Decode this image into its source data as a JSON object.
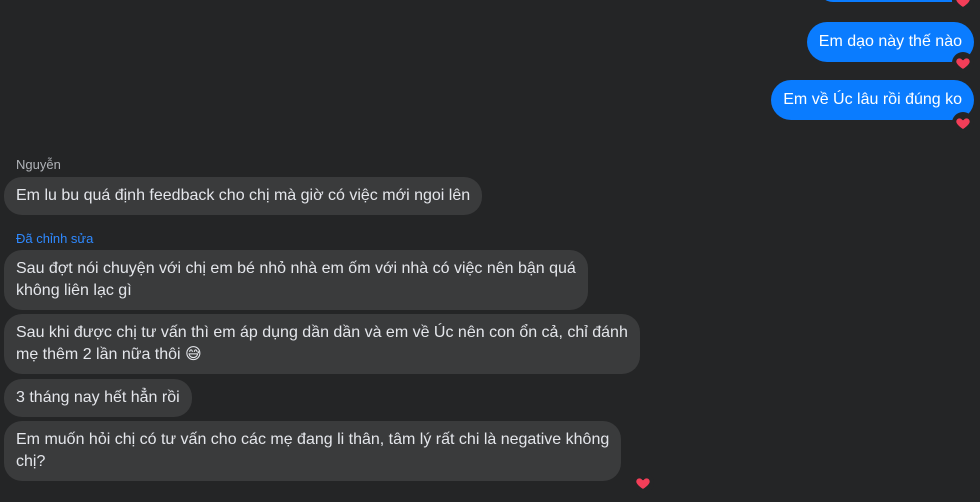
{
  "outgoing": {
    "msg1": "Em dạo này thế nào",
    "msg2": "Em về Úc lâu rồi đúng ko"
  },
  "incoming": {
    "sender_name": "Nguyễn",
    "msg1": "Em lu bu quá định feedback cho chị mà giờ có việc mới ngoi lên",
    "edited_label": "Đã chỉnh sửa",
    "msg2_line1": "Sau đợt nói chuyện với chị em bé nhỏ nhà em ốm với nhà có việc nên bận quá",
    "msg2_line2": "không liên lạc gì",
    "msg3_line1": "Sau khi được chị tư vấn thì em áp dụng dần dần và em về Úc nên con ổn cả, chỉ đánh",
    "msg3_line2": "mẹ thêm 2 lần nữa thôi 😅",
    "msg4": "3 tháng nay hết hẳn rồi",
    "msg5_line1": "Em muốn hỏi chị có tư vấn cho các mẹ đang li thân, tâm lý rất chi là negative không",
    "msg5_line2": "chị?"
  },
  "reaction_icon": "heart-icon",
  "colors": {
    "background": "#242526",
    "outgoing_bubble": "#0a7cff",
    "incoming_bubble": "#3a3b3c",
    "edited_label": "#2e89ff",
    "heart": "#f33e58"
  }
}
